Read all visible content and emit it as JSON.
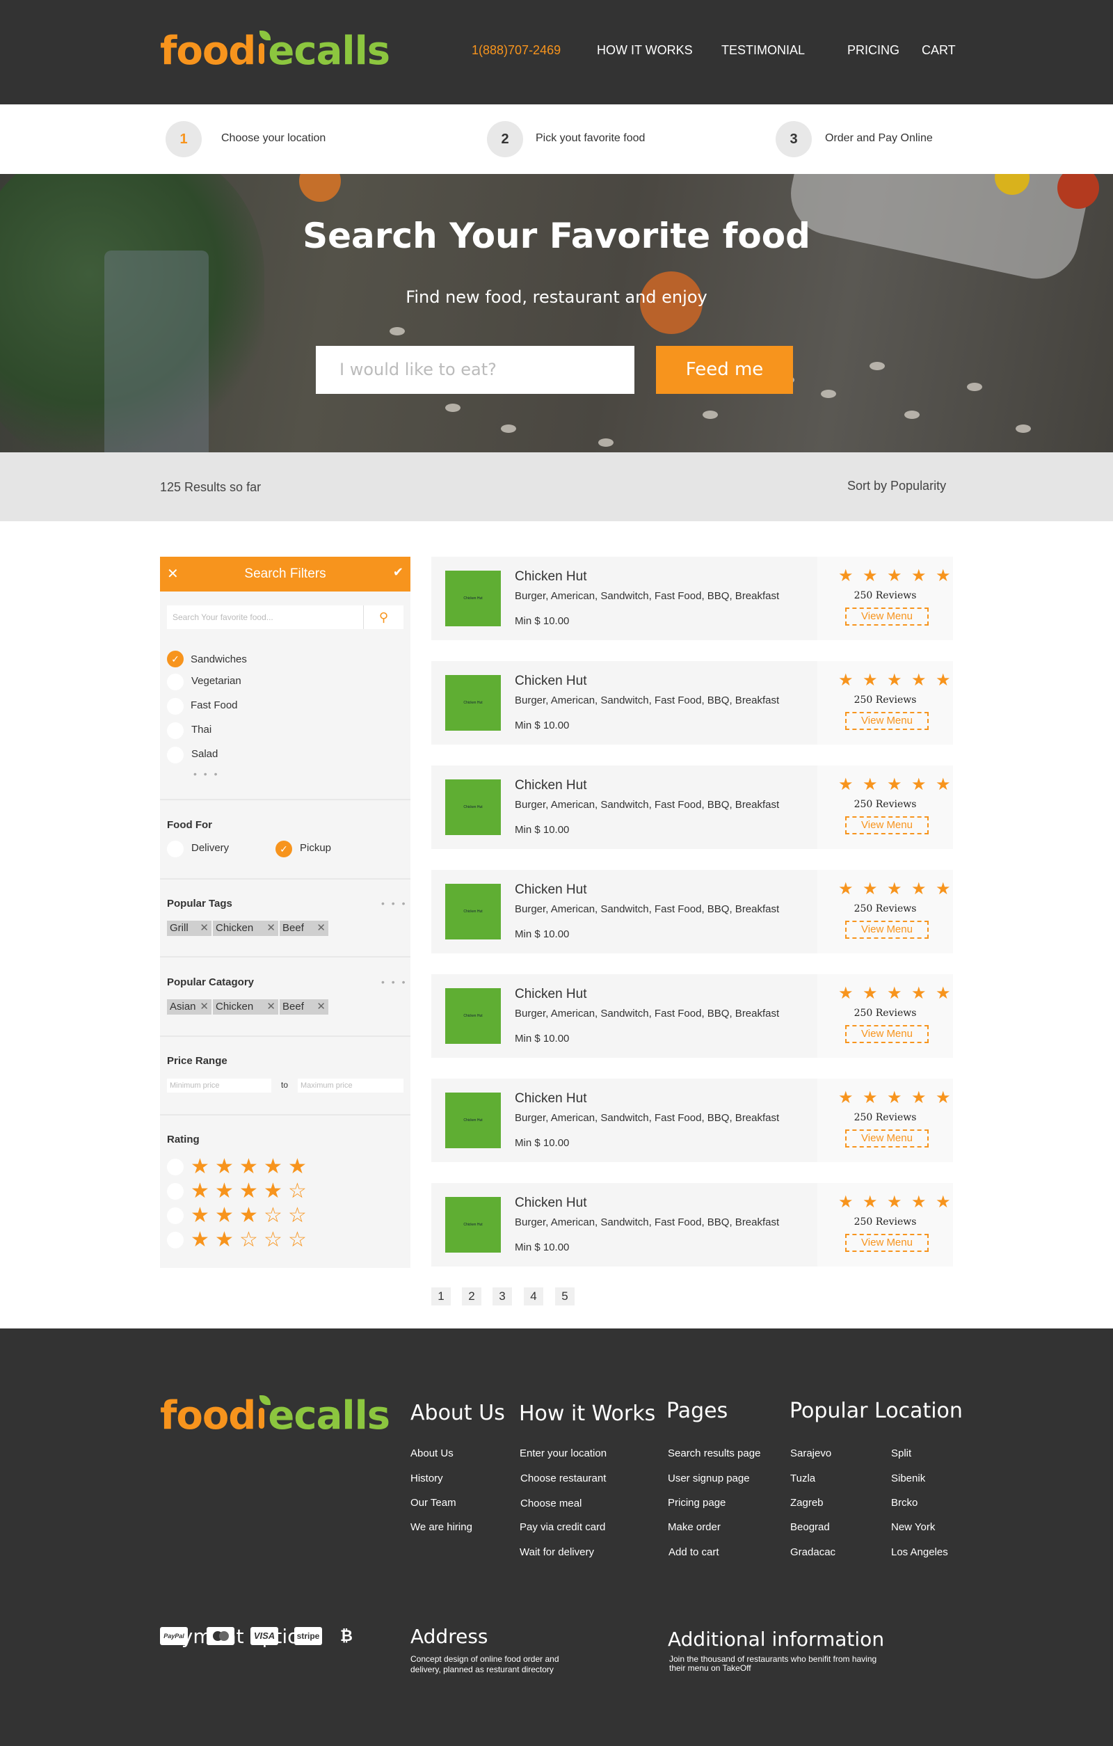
{
  "brand": {
    "logo_part1": "food",
    "logo_part2": "ecalls",
    "orange": "#f7941d",
    "green": "#8cc63f",
    "dark": "#333333"
  },
  "nav": {
    "phone": "1(888)707-2469",
    "how": "HOW IT WORKS",
    "testimonial": "TESTIMONIAL",
    "pricing": "PRICING",
    "cart": "CART"
  },
  "steps": [
    {
      "num": "1",
      "label": "Choose your location"
    },
    {
      "num": "2",
      "label": "Pick yout favorite food"
    },
    {
      "num": "3",
      "label": "Order and Pay Online"
    }
  ],
  "hero": {
    "title": "Search Your Favorite food",
    "subtitle": "Find new food, restaurant and enjoy",
    "placeholder": "I would like to eat?",
    "button": "Feed me"
  },
  "results": {
    "count": "125 Results so far",
    "sort": "Sort by Popularity"
  },
  "filters": {
    "title": "Search Filters",
    "search_placeholder": "Search Your favorite food...",
    "food_types": [
      {
        "label": "Sandwiches",
        "checked": true
      },
      {
        "label": "Vegetarian",
        "checked": false
      },
      {
        "label": "Fast Food",
        "checked": false
      },
      {
        "label": "Thai",
        "checked": false
      },
      {
        "label": "Salad",
        "checked": false
      }
    ],
    "more": "• • •",
    "food_for_title": "Food For",
    "delivery": "Delivery",
    "pickup": "Pickup",
    "tags_title": "Popular Tags",
    "tags": [
      "Grill",
      "Chicken",
      "Beef"
    ],
    "category_title": "Popular Catagory",
    "categories": [
      "Asian",
      "Chicken",
      "Beef"
    ],
    "price_title": "Price Range",
    "min_placeholder": "Minimum price",
    "max_placeholder": "Maximum price",
    "to": "to",
    "rating_title": "Rating",
    "ratings": [
      5,
      4,
      3,
      2
    ]
  },
  "restaurants": [
    {
      "name": "Chicken Hut",
      "cuisine": "Burger, American, Sandwitch, Fast Food, BBQ, Breakfast",
      "min": "Min $ 10.00",
      "rating": 5,
      "reviews": "250 Reviews",
      "button": "View Menu",
      "logo_text": "Chicken Hut"
    },
    {
      "name": "Chicken Hut",
      "cuisine": "Burger, American, Sandwitch, Fast Food, BBQ, Breakfast",
      "min": "Min $ 10.00",
      "rating": 5,
      "reviews": "250 Reviews",
      "button": "View Menu",
      "logo_text": "Chicken Hut"
    },
    {
      "name": "Chicken Hut",
      "cuisine": "Burger, American, Sandwitch, Fast Food, BBQ, Breakfast",
      "min": "Min $ 10.00",
      "rating": 5,
      "reviews": "250 Reviews",
      "button": "View Menu",
      "logo_text": "Chicken Hut"
    },
    {
      "name": "Chicken Hut",
      "cuisine": "Burger, American, Sandwitch, Fast Food, BBQ, Breakfast",
      "min": "Min $ 10.00",
      "rating": 5,
      "reviews": "250 Reviews",
      "button": "View Menu",
      "logo_text": "Chicken Hut"
    },
    {
      "name": "Chicken Hut",
      "cuisine": "Burger, American, Sandwitch, Fast Food, BBQ, Breakfast",
      "min": "Min $ 10.00",
      "rating": 5,
      "reviews": "250 Reviews",
      "button": "View Menu",
      "logo_text": "Chicken Hut"
    },
    {
      "name": "Chicken Hut",
      "cuisine": "Burger, American, Sandwitch, Fast Food, BBQ, Breakfast",
      "min": "Min $ 10.00",
      "rating": 5,
      "reviews": "250 Reviews",
      "button": "View Menu",
      "logo_text": "Chicken Hut"
    },
    {
      "name": "Chicken Hut",
      "cuisine": "Burger, American, Sandwitch, Fast Food, BBQ, Breakfast",
      "min": "Min $ 10.00",
      "rating": 5,
      "reviews": "250 Reviews",
      "button": "View Menu",
      "logo_text": "Chicken Hut"
    }
  ],
  "pagination": [
    "1",
    "2",
    "3",
    "4",
    "5"
  ],
  "footer": {
    "about_title": "About Us",
    "about_links": [
      "About Us",
      "History",
      "Our Team",
      "We are hiring"
    ],
    "how_title": "How it Works",
    "how_links": [
      "Enter your location",
      "Choose restaurant",
      "Choose meal",
      "Pay via credit card",
      "Wait for delivery"
    ],
    "pages_title": "Pages",
    "pages_links": [
      "Search results page",
      "User signup page",
      "Pricing page",
      "Make order",
      "Add to cart"
    ],
    "location_title": "Popular Location",
    "locations_col1": [
      "Sarajevo",
      "Tuzla",
      "Zagreb",
      "Beograd",
      "Gradacac"
    ],
    "locations_col2": [
      "Split",
      "Sibenik",
      "Brcko",
      "New York",
      "Los Angeles"
    ],
    "payment_title": "Payment option",
    "payment_methods": [
      "PayPal",
      "Mastercard",
      "VISA",
      "stripe",
      "₿"
    ],
    "address_title": "Address",
    "address_text_1": "Concept design of online food order and",
    "address_text_2": "delivery, planned as resturant directory",
    "info_title": "Additional information",
    "info_text_1": "Join the thousand of restaurants who benifit from having",
    "info_text_2": "their menu on TakeOff"
  }
}
